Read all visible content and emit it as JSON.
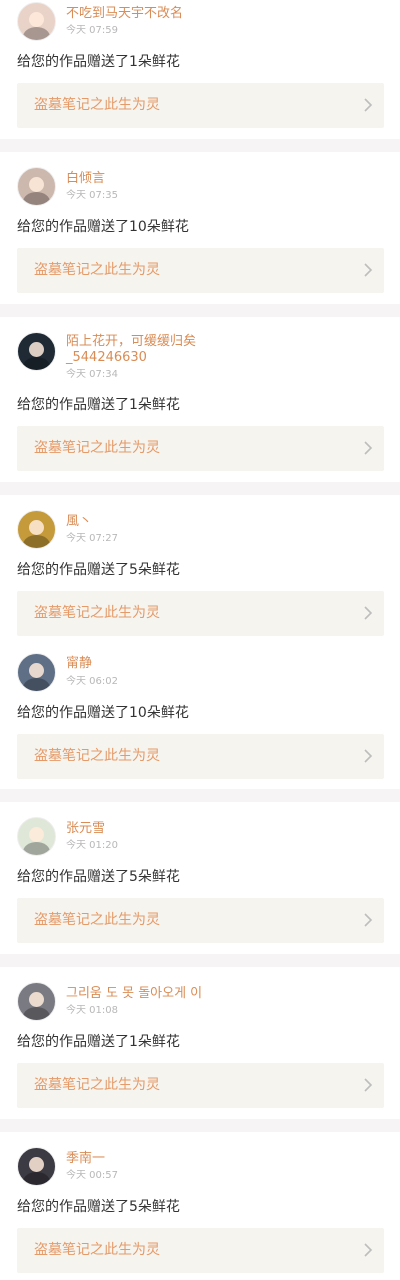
{
  "feed": [
    {
      "name": "不吃到马天宇不改名",
      "time": "今天 07:59",
      "message": "给您的作品赠送了1朵鲜花",
      "work": "盗墓笔记之此生为灵",
      "avatar_color": "#e9d2c8"
    },
    {
      "name": "白倾言",
      "time": "今天 07:35",
      "message": "给您的作品赠送了10朵鲜花",
      "work": "盗墓笔记之此生为灵",
      "avatar_color": "#cdb8ae"
    },
    {
      "name": "陌上花开，可缓缓归矣_544246630",
      "time": "今天 07:34",
      "message": "给您的作品赠送了1朵鲜花",
      "work": "盗墓笔记之此生为灵",
      "avatar_color": "#1f2a35"
    },
    {
      "name": "風丶",
      "time": "今天 07:27",
      "message": "给您的作品赠送了5朵鲜花",
      "work": "盗墓笔记之此生为灵",
      "avatar_color": "#c49a3a"
    },
    {
      "name": "甯静",
      "time": "今天 06:02",
      "message": "给您的作品赠送了10朵鲜花",
      "work": "盗墓笔记之此生为灵",
      "avatar_color": "#5f6f86"
    },
    {
      "name": "张元雪",
      "time": "今天 01:20",
      "message": "给您的作品赠送了5朵鲜花",
      "work": "盗墓笔记之此生为灵",
      "avatar_color": "#dfe7d8"
    },
    {
      "name": "그리움 도 못 돌아오게 이",
      "time": "今天 01:08",
      "message": "给您的作品赠送了1朵鲜花",
      "work": "盗墓笔记之此生为灵",
      "avatar_color": "#7a7b82"
    },
    {
      "name": "季南一",
      "time": "今天 00:57",
      "message": "给您的作品赠送了5朵鲜花",
      "work": "盗墓笔记之此生为灵",
      "avatar_color": "#3c3a42"
    }
  ],
  "colors": {
    "accent": "#e59a68",
    "name": "#d98c55",
    "work_bg": "#f5f4ef",
    "separator": "#f6f4f4"
  }
}
